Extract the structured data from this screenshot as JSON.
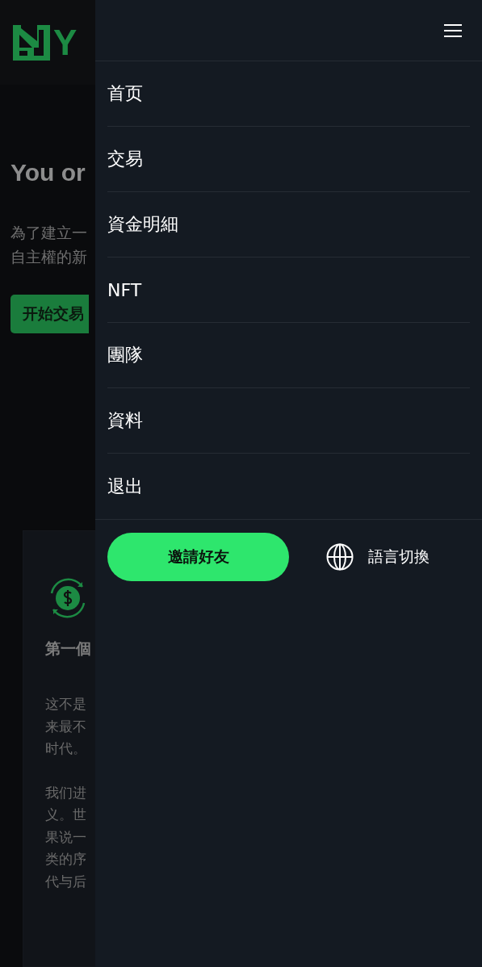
{
  "background_page": {
    "logo_text": "Y",
    "hero_title": "You or",
    "hero_lines": [
      "為了建立一",
      "自主權的新"
    ],
    "cta": "开始交易",
    "card": {
      "title": "第一個",
      "paragraphs": [
        [
          "这不是",
          "来最不",
          "时代。"
        ],
        [
          "我们进",
          "义。世",
          "果说一",
          "类的序",
          "代与后"
        ]
      ]
    }
  },
  "drawer": {
    "menu_items": [
      {
        "label": "首页"
      },
      {
        "label": "交易"
      },
      {
        "label": "資金明細"
      },
      {
        "label": "NFT"
      },
      {
        "label": "團隊"
      },
      {
        "label": "資料"
      },
      {
        "label": "退出"
      }
    ],
    "invite_button": "邀請好友",
    "language_switch": "語言切換"
  }
}
